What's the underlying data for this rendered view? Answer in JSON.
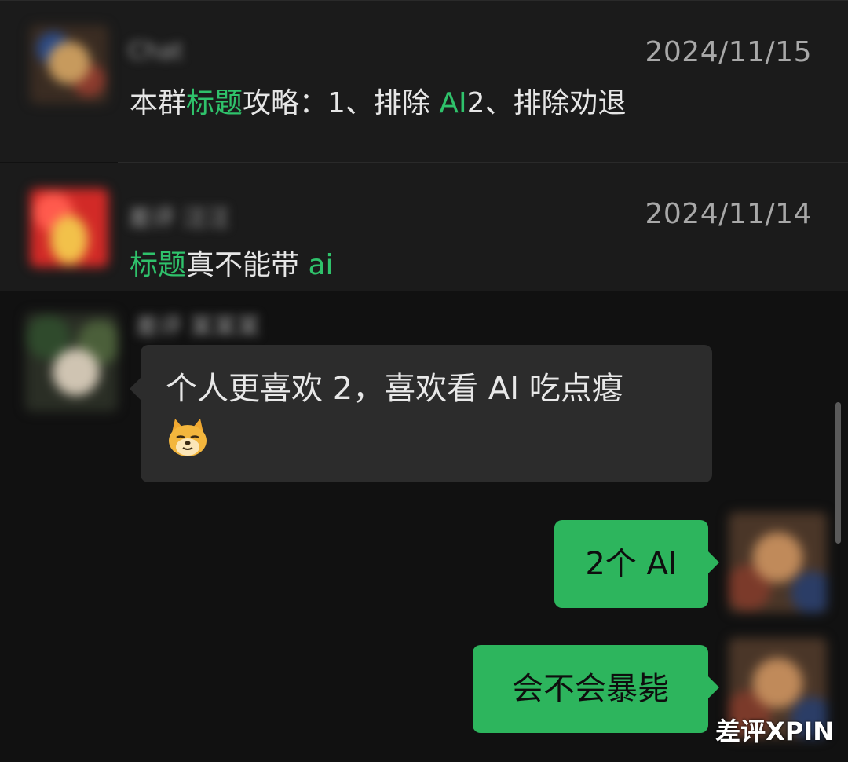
{
  "history": [
    {
      "sender": "Chat",
      "date": "2024/11/15",
      "message_parts": [
        {
          "text": "本群",
          "highlight": false
        },
        {
          "text": "标题",
          "highlight": true
        },
        {
          "text": "攻略：1、排除 ",
          "highlight": false
        },
        {
          "text": "AI",
          "highlight": true
        },
        {
          "text": "2、排除劝退",
          "highlight": false
        }
      ]
    },
    {
      "sender": "差评 汪汪",
      "date": "2024/11/14",
      "message_parts": [
        {
          "text": "标题",
          "highlight": true
        },
        {
          "text": "真不能带 ",
          "highlight": false
        },
        {
          "text": "ai",
          "highlight": true
        }
      ]
    }
  ],
  "chat": {
    "incoming": {
      "sender": "差评 某某某",
      "text_line1": "个人更喜欢 2，喜欢看 AI 吃点瘪",
      "emoji": "doge-icon"
    },
    "outgoing": [
      {
        "text": "2个 AI"
      },
      {
        "text": "会不会暴毙"
      }
    ]
  },
  "watermark": "差评XPIN",
  "colors": {
    "background": "#111111",
    "row_background": "#1b1b1b",
    "highlight": "#2fc26b",
    "outgoing_bubble": "#2db55d",
    "incoming_bubble": "#2c2c2c"
  }
}
